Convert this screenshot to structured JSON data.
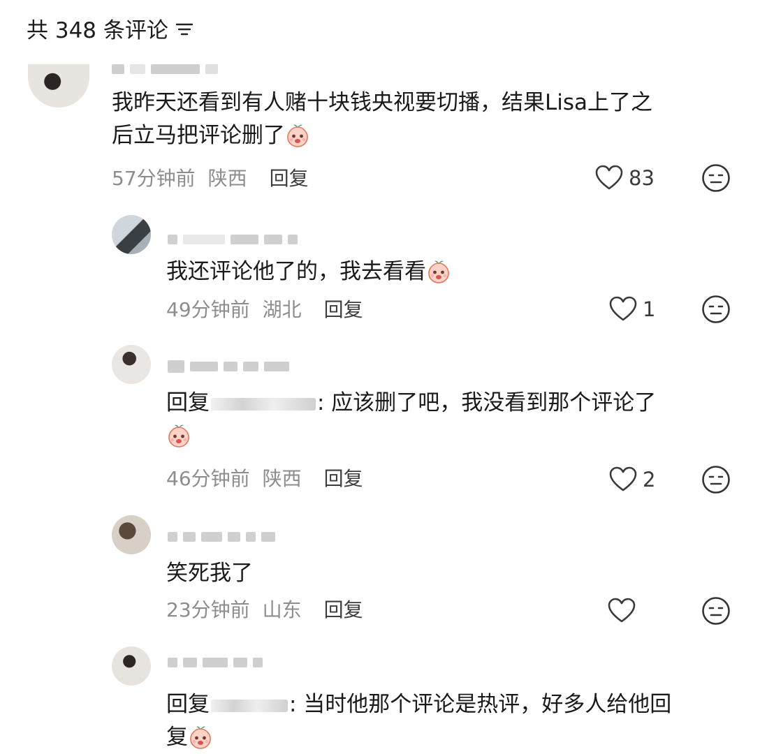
{
  "header": {
    "title": "共 348 条评论",
    "sort_icon": "sort-icon"
  },
  "comments": [
    {
      "text": "我昨天还看到有人赌十块钱央视要切播，结果Lisa上了之\n后立马把评论删了",
      "time": "57分钟前",
      "location": "陕西",
      "reply_label": "回复",
      "likes": "83",
      "emoji": "peach-shy-emoji"
    },
    {
      "text": "我还评论他了的，我去看看",
      "time": "49分钟前",
      "location": "湖北",
      "reply_label": "回复",
      "likes": "1",
      "emoji": "peach-crying-emoji"
    },
    {
      "reply_prefix": "回复",
      "text": ": 应该删了吧，我没看到那个评论了",
      "time": "46分钟前",
      "location": "陕西",
      "reply_label": "回复",
      "likes": "2",
      "emoji": "peach-crying-emoji"
    },
    {
      "text": "笑死我了",
      "time": "23分钟前",
      "location": "山东",
      "reply_label": "回复",
      "likes": ""
    },
    {
      "reply_prefix": "回复",
      "text": ": 当时他那个评论是热评，好多人给他回\n复",
      "emoji": "peach-shy-emoji"
    }
  ],
  "colors": {
    "meta": "#8d8d8d",
    "text": "#1a1a1a",
    "icon": "#3a3a3a"
  }
}
